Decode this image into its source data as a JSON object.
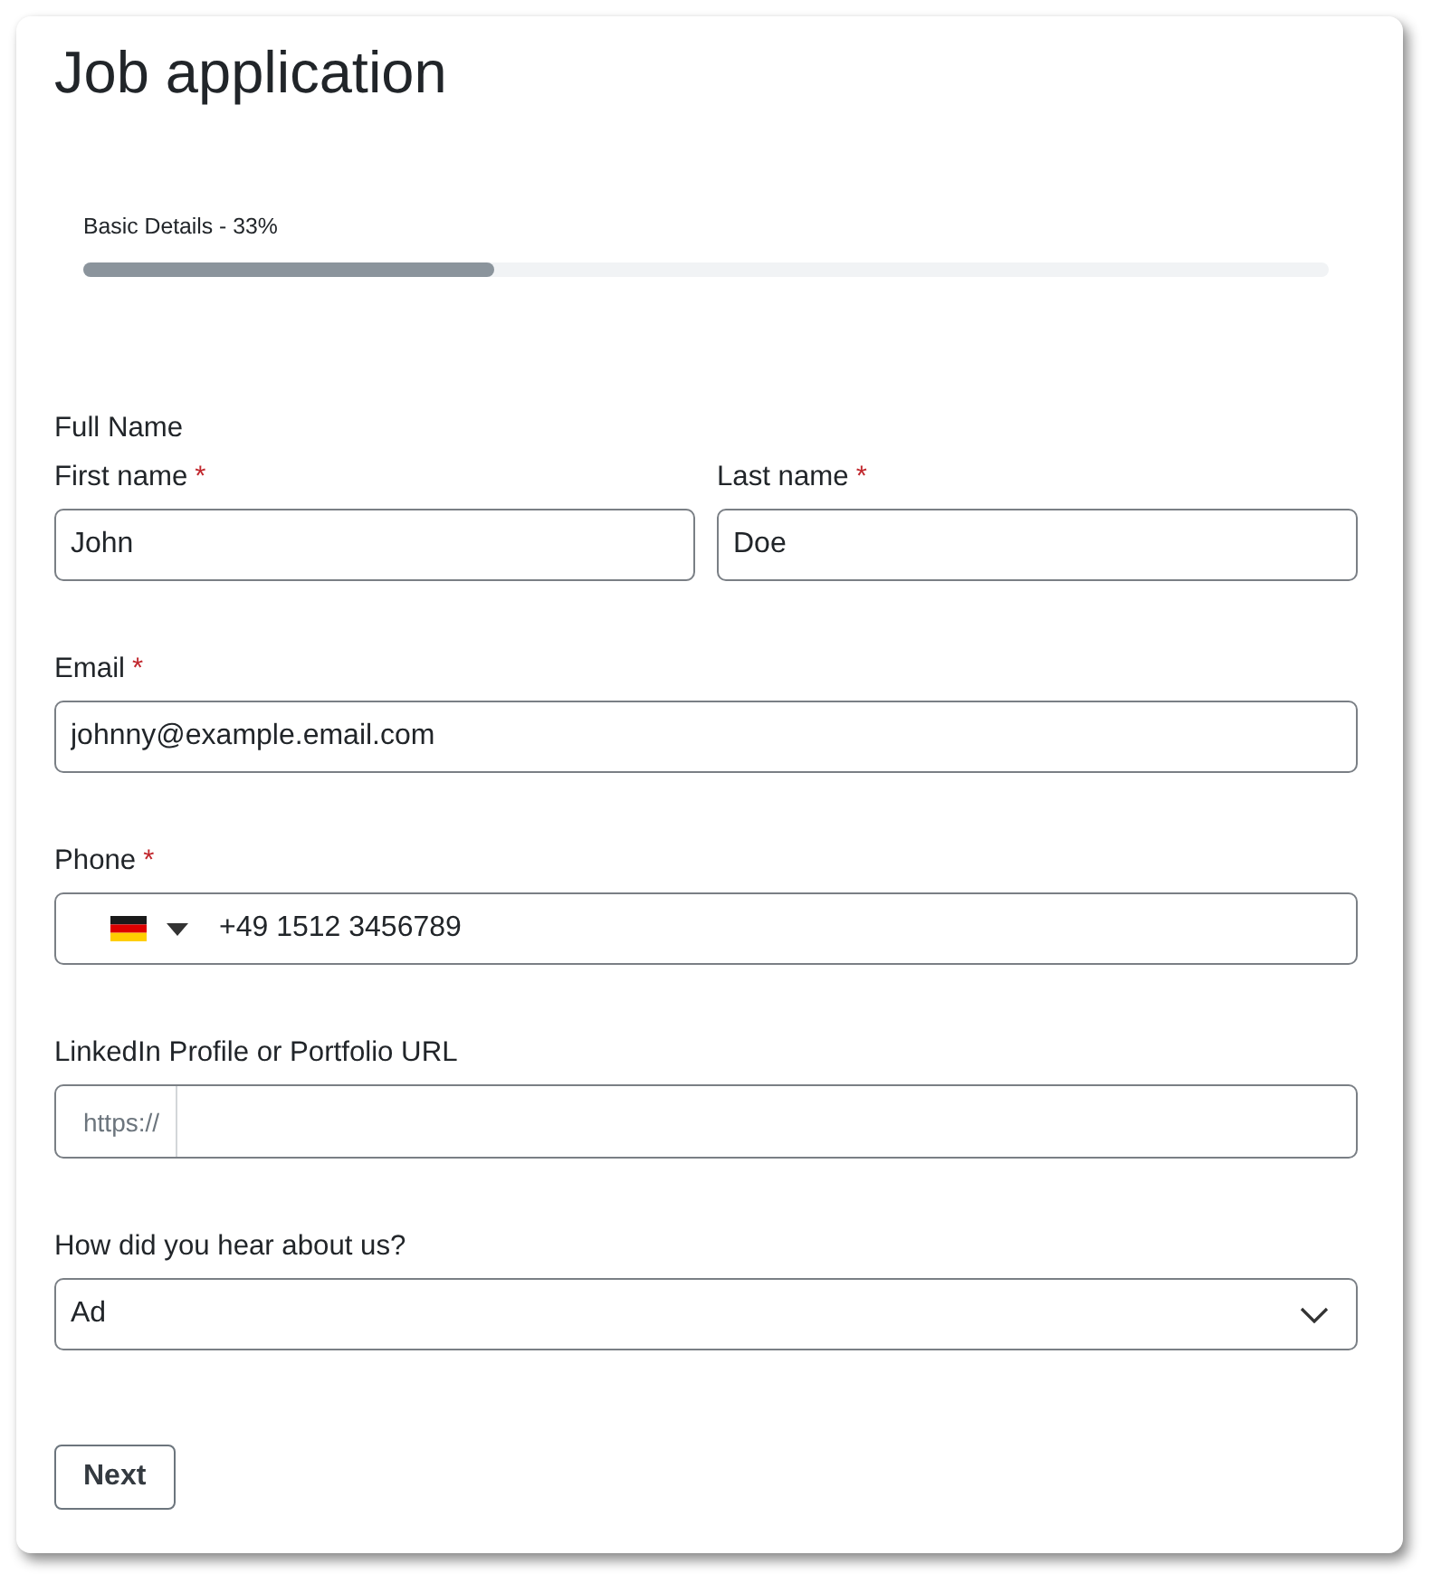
{
  "title": "Job application",
  "progress": {
    "label": "Basic Details - 33%",
    "level": 0.33
  },
  "fields": [
    {
      "kind": "name_group",
      "label": "Full Name",
      "parts": [
        {
          "label": "First name",
          "required_mark": "*",
          "value": "John"
        },
        {
          "label": "Last name",
          "required_mark": "*",
          "value": "Doe"
        }
      ]
    },
    {
      "kind": "text",
      "label": "Email",
      "required_mark": "*",
      "value": "johnny@example.email.com"
    },
    {
      "kind": "phone",
      "label": "Phone",
      "required_mark": "*",
      "value": "+49 1512 3456789"
    },
    {
      "kind": "url",
      "label": "LinkedIn Profile or Portfolio URL",
      "prefix": "https://"
    },
    {
      "kind": "select",
      "label": "How did you hear about us?",
      "value": "Ad"
    }
  ],
  "buttons": [
    {
      "label": "Next"
    }
  ]
}
